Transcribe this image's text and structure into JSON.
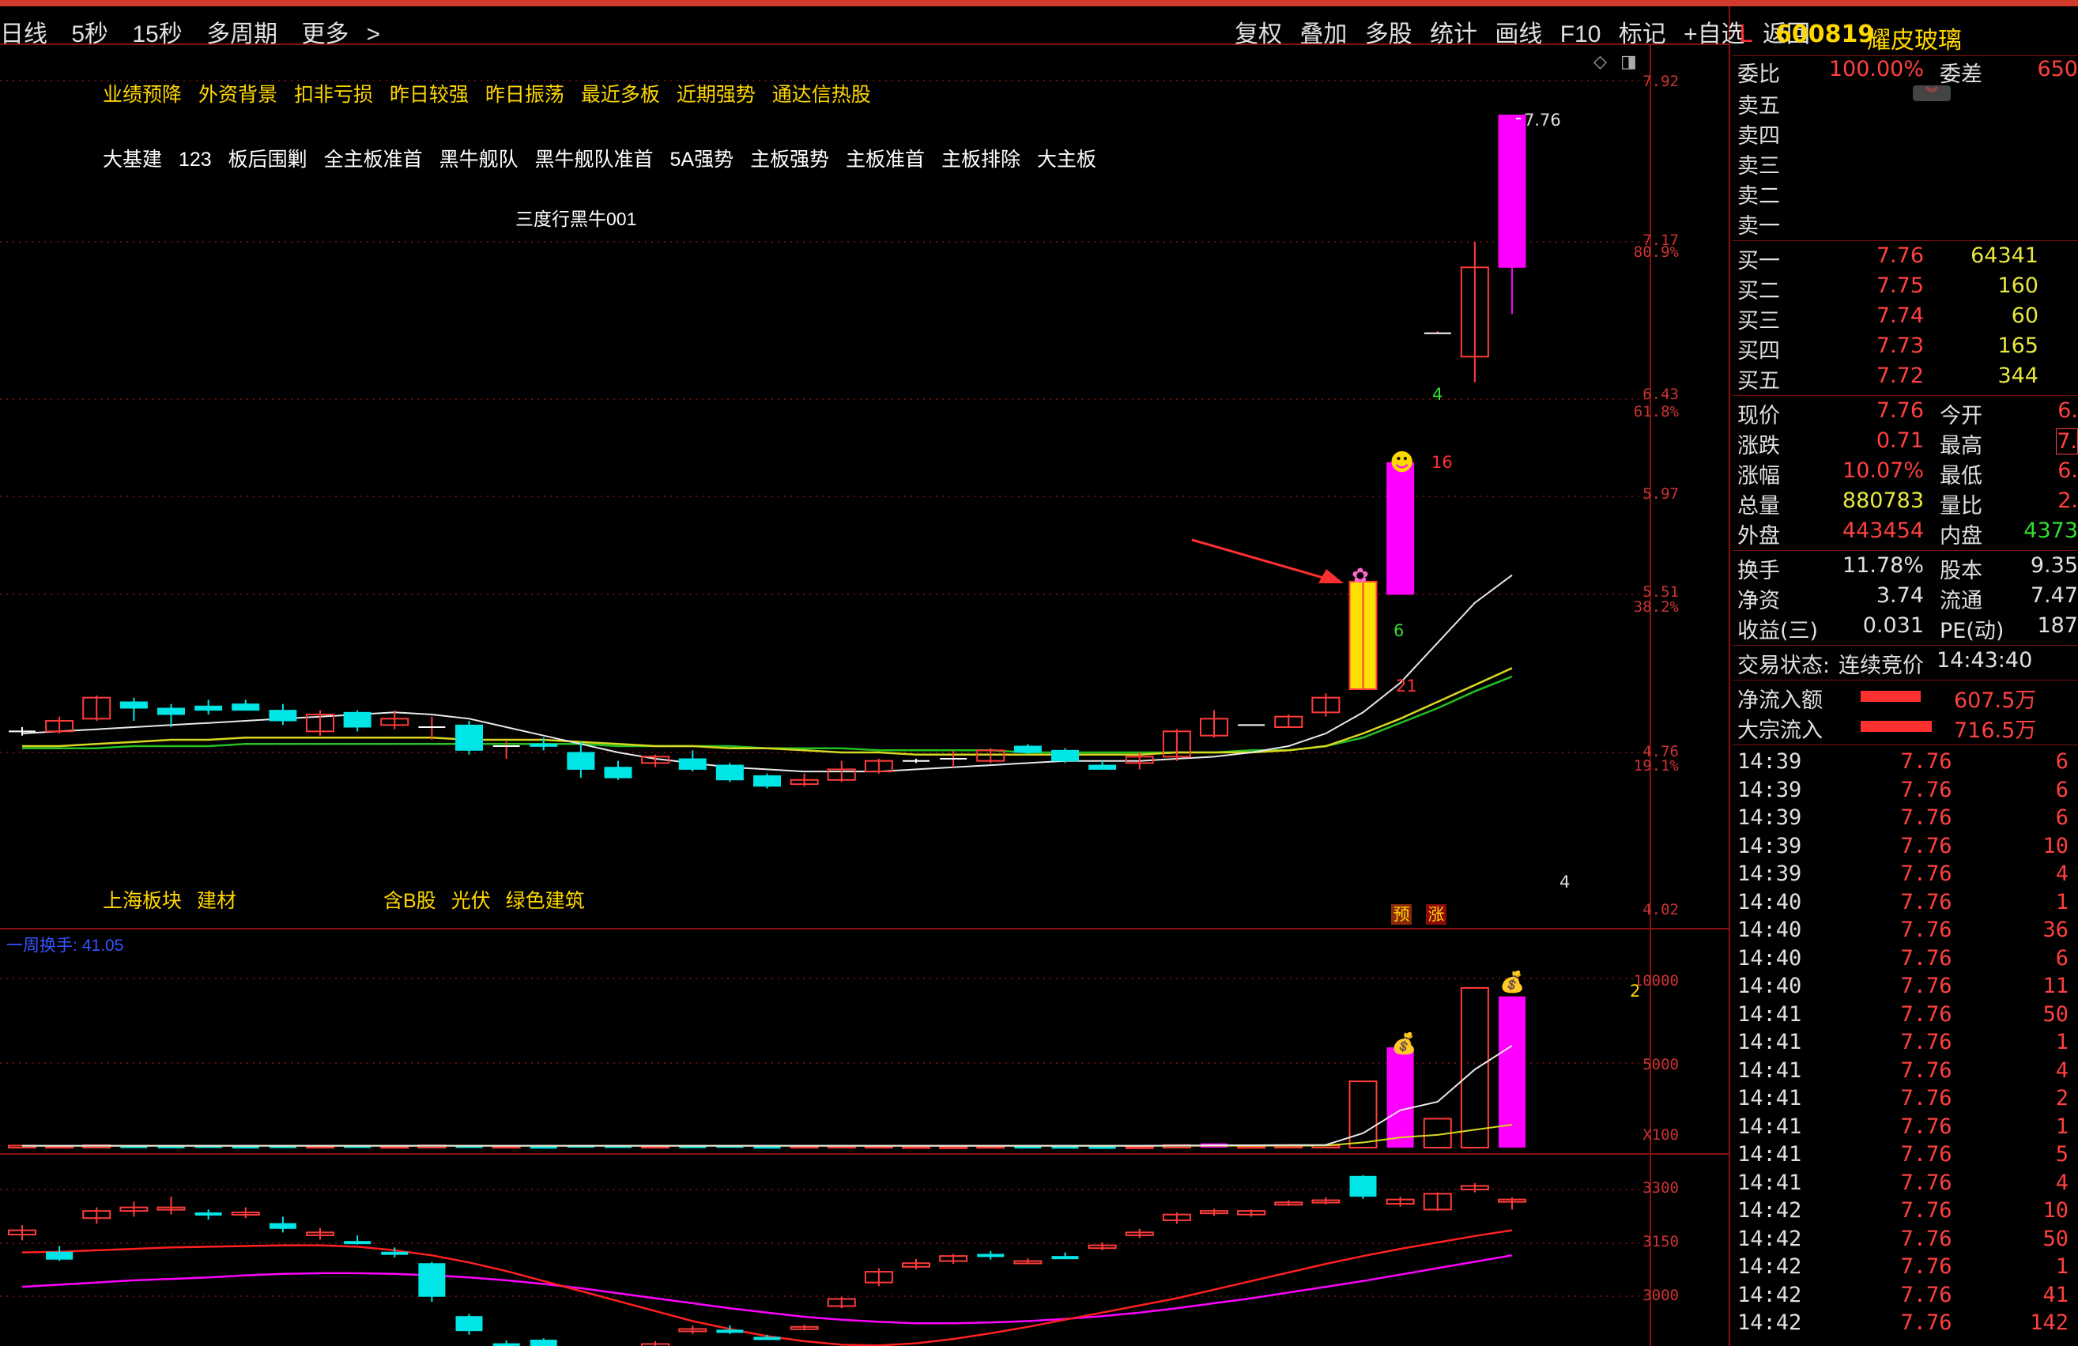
{
  "toolbar": {
    "left": [
      "日线",
      "5秒",
      "15秒",
      "多周期",
      "更多"
    ],
    "right": [
      "复权",
      "叠加",
      "多股",
      "统计",
      "画线",
      "F10",
      "标记",
      "+自选",
      "返回"
    ]
  },
  "tags": {
    "yellow": [
      "业绩预降",
      "外资背景",
      "扣非亏损",
      "昨日较强",
      "昨日振荡",
      "最近多板",
      "近期强势",
      "通达信热股"
    ],
    "white": [
      "大基建",
      "123",
      "板后围剿",
      "全主板准首",
      "黑牛舰队",
      "黑牛舰队准首",
      "5A强势",
      "主板强势",
      "主板准首",
      "主板排除",
      "大主板"
    ]
  },
  "formula_name": "三度行黑牛001",
  "board_left": [
    "上海板块",
    "建材"
  ],
  "board_mid": [
    "含B股",
    "光伏",
    "绿色建筑"
  ],
  "chart_labels": {
    "high_price": "7.76",
    "counts": [
      "21",
      "6",
      "16",
      "4",
      "4",
      "2"
    ],
    "yu": "预",
    "zhang": "涨"
  },
  "price_axis": [
    "7.92",
    "7.17",
    "6.43",
    "5.97",
    "5.51",
    "4.76",
    "4.02"
  ],
  "pct_axis": [
    "80.9%",
    "61.8%",
    "38.2%",
    "19.1%"
  ],
  "vol_title": {
    "label": "一周换手:",
    "value": "41.05"
  },
  "vol_axis": [
    "10000",
    "5000",
    "X100"
  ],
  "ind_axis": [
    "3300",
    "3150",
    "3000"
  ],
  "chart_data": {
    "type": "candlestick",
    "candles": [
      [
        4.86,
        4.86,
        4.88,
        4.84
      ],
      [
        4.86,
        4.91,
        4.93,
        4.85
      ],
      [
        4.92,
        5.02,
        5.03,
        4.91
      ],
      [
        5.0,
        4.97,
        5.02,
        4.91
      ],
      [
        4.97,
        4.94,
        4.99,
        4.88
      ],
      [
        4.98,
        4.96,
        5.01,
        4.94
      ],
      [
        4.99,
        4.96,
        5.01,
        4.96
      ],
      [
        4.96,
        4.91,
        4.99,
        4.89
      ],
      [
        4.86,
        4.94,
        4.96,
        4.84
      ],
      [
        4.95,
        4.88,
        4.96,
        4.86
      ],
      [
        4.89,
        4.92,
        4.96,
        4.87
      ],
      [
        4.88,
        4.88,
        4.93,
        4.82
      ],
      [
        4.89,
        4.77,
        4.91,
        4.75
      ],
      [
        4.79,
        4.79,
        4.81,
        4.73
      ],
      [
        4.8,
        4.79,
        4.83,
        4.77
      ],
      [
        4.76,
        4.68,
        4.81,
        4.64
      ],
      [
        4.69,
        4.64,
        4.72,
        4.63
      ],
      [
        4.71,
        4.74,
        4.75,
        4.69
      ],
      [
        4.73,
        4.68,
        4.77,
        4.67
      ],
      [
        4.7,
        4.63,
        4.71,
        4.62
      ],
      [
        4.65,
        4.6,
        4.66,
        4.59
      ],
      [
        4.61,
        4.63,
        4.66,
        4.6
      ],
      [
        4.63,
        4.68,
        4.72,
        4.62
      ],
      [
        4.67,
        4.72,
        4.73,
        4.66
      ],
      [
        4.72,
        4.72,
        4.73,
        4.71
      ],
      [
        4.73,
        4.73,
        4.77,
        4.69
      ],
      [
        4.72,
        4.77,
        4.78,
        4.71
      ],
      [
        4.79,
        4.76,
        4.8,
        4.75
      ],
      [
        4.77,
        4.72,
        4.78,
        4.71
      ],
      [
        4.7,
        4.68,
        4.72,
        4.68
      ],
      [
        4.71,
        4.74,
        4.76,
        4.68
      ],
      [
        4.74,
        4.86,
        4.87,
        4.72
      ],
      [
        4.84,
        4.92,
        4.96,
        4.83
      ],
      [
        4.89,
        4.89,
        4.89,
        4.89
      ],
      [
        4.88,
        4.93,
        4.94,
        4.88
      ],
      [
        4.95,
        5.02,
        5.04,
        4.93
      ],
      [
        5.06,
        5.57,
        5.57,
        5.06
      ],
      [
        5.51,
        6.13,
        6.13,
        5.51
      ],
      [
        6.74,
        6.74,
        6.75,
        6.74
      ],
      [
        6.63,
        7.05,
        7.17,
        6.51
      ],
      [
        7.05,
        7.76,
        7.76,
        6.83
      ]
    ],
    "ma_white": [
      4.85,
      4.86,
      4.87,
      4.88,
      4.89,
      4.9,
      4.91,
      4.92,
      4.93,
      4.94,
      4.95,
      4.94,
      4.92,
      4.88,
      4.84,
      4.8,
      4.76,
      4.73,
      4.71,
      4.69,
      4.68,
      4.67,
      4.67,
      4.67,
      4.68,
      4.69,
      4.7,
      4.71,
      4.72,
      4.72,
      4.72,
      4.73,
      4.74,
      4.76,
      4.79,
      4.85,
      4.95,
      5.09,
      5.28,
      5.47,
      5.6
    ],
    "ma_yellow": [
      4.79,
      4.79,
      4.8,
      4.81,
      4.82,
      4.82,
      4.83,
      4.83,
      4.83,
      4.83,
      4.83,
      4.83,
      4.82,
      4.82,
      4.82,
      4.81,
      4.8,
      4.79,
      4.79,
      4.78,
      4.78,
      4.77,
      4.76,
      4.76,
      4.75,
      4.75,
      4.75,
      4.75,
      4.75,
      4.75,
      4.75,
      4.76,
      4.76,
      4.76,
      4.77,
      4.79,
      4.85,
      4.92,
      5.0,
      5.08,
      5.16
    ],
    "ma_green": [
      4.78,
      4.78,
      4.78,
      4.79,
      4.79,
      4.79,
      4.8,
      4.8,
      4.8,
      4.8,
      4.8,
      4.8,
      4.8,
      4.8,
      4.8,
      4.8,
      4.79,
      4.79,
      4.79,
      4.79,
      4.78,
      4.78,
      4.78,
      4.77,
      4.77,
      4.77,
      4.77,
      4.76,
      4.76,
      4.76,
      4.76,
      4.76,
      4.76,
      4.77,
      4.77,
      4.79,
      4.83,
      4.9,
      4.97,
      5.05,
      5.12
    ],
    "volume": [
      120,
      90,
      140,
      110,
      100,
      120,
      90,
      110,
      90,
      120,
      80,
      130,
      120,
      90,
      80,
      150,
      120,
      90,
      110,
      130,
      80,
      90,
      100,
      90,
      70,
      60,
      80,
      90,
      80,
      70,
      60,
      150,
      250,
      80,
      100,
      120,
      3900,
      5900,
      1700,
      9400,
      8900
    ],
    "volume_ma": [
      110,
      110,
      110,
      110,
      110,
      110,
      110,
      110,
      110,
      110,
      110,
      110,
      110,
      110,
      110,
      110,
      110,
      110,
      110,
      110,
      110,
      110,
      110,
      110,
      110,
      110,
      110,
      110,
      110,
      110,
      110,
      120,
      140,
      140,
      150,
      160,
      850,
      2200,
      2700,
      4600,
      6000
    ],
    "volume_ma2": [
      100,
      100,
      100,
      100,
      100,
      100,
      100,
      100,
      100,
      100,
      100,
      100,
      100,
      100,
      100,
      100,
      100,
      100,
      100,
      100,
      100,
      100,
      100,
      100,
      100,
      100,
      100,
      100,
      100,
      100,
      100,
      105,
      110,
      110,
      115,
      120,
      300,
      600,
      750,
      1050,
      1350
    ],
    "index": [
      [
        3237,
        3243,
        3250,
        3229
      ],
      [
        3213,
        3202,
        3221,
        3200
      ],
      [
        3260,
        3270,
        3275,
        3252
      ],
      [
        3270,
        3275,
        3283,
        3262
      ],
      [
        3274,
        3275,
        3290,
        3265
      ],
      [
        3268,
        3265,
        3272,
        3258
      ],
      [
        3265,
        3268,
        3275,
        3260
      ],
      [
        3253,
        3245,
        3262,
        3240
      ],
      [
        3236,
        3240,
        3246,
        3230
      ],
      [
        3228,
        3227,
        3236,
        3223
      ],
      [
        3213,
        3210,
        3219,
        3205
      ],
      [
        3197,
        3150,
        3199,
        3143
      ],
      [
        3123,
        3102,
        3126,
        3097
      ],
      [
        3085,
        3083,
        3089,
        3078
      ],
      [
        3090,
        3063,
        3092,
        3056
      ],
      [
        3044,
        3040,
        3048,
        3034
      ],
      [
        3048,
        3060,
        3064,
        3045
      ],
      [
        3075,
        3084,
        3088,
        3073
      ],
      [
        3103,
        3105,
        3110,
        3098
      ],
      [
        3104,
        3101,
        3110,
        3098
      ],
      [
        3094,
        3093,
        3097,
        3090
      ],
      [
        3105,
        3108,
        3111,
        3103
      ],
      [
        3137,
        3147,
        3150,
        3134
      ],
      [
        3170,
        3185,
        3190,
        3165
      ],
      [
        3192,
        3197,
        3203,
        3188
      ],
      [
        3200,
        3207,
        3210,
        3196
      ],
      [
        3210,
        3206,
        3214,
        3202
      ],
      [
        3200,
        3200,
        3204,
        3197
      ],
      [
        3207,
        3206,
        3212,
        3204
      ],
      [
        3218,
        3222,
        3226,
        3215
      ],
      [
        3236,
        3240,
        3245,
        3232
      ],
      [
        3257,
        3265,
        3268,
        3252
      ],
      [
        3267,
        3270,
        3273,
        3263
      ],
      [
        3265,
        3270,
        3272,
        3262
      ],
      [
        3280,
        3282,
        3285,
        3277
      ],
      [
        3283,
        3285,
        3289,
        3279
      ],
      [
        3319,
        3290,
        3320,
        3287
      ],
      [
        3280,
        3286,
        3290,
        3276
      ],
      [
        3272,
        3294,
        3296,
        3270
      ],
      [
        3300,
        3305,
        3309,
        3296
      ],
      [
        3283,
        3286,
        3289,
        3272
      ]
    ],
    "index_ma_red": [
      3212,
      3213,
      3215,
      3217,
      3219,
      3220,
      3221,
      3222,
      3222,
      3220,
      3215,
      3208,
      3198,
      3186,
      3172,
      3158,
      3144,
      3130,
      3116,
      3105,
      3095,
      3088,
      3083,
      3082,
      3085,
      3091,
      3099,
      3108,
      3118,
      3128,
      3138,
      3148,
      3160,
      3172,
      3184,
      3196,
      3207,
      3217,
      3226,
      3235,
      3243
    ],
    "index_ma_magenta": [
      3164,
      3167,
      3170,
      3173,
      3175,
      3177,
      3180,
      3182,
      3183,
      3183,
      3182,
      3180,
      3177,
      3173,
      3168,
      3162,
      3155,
      3148,
      3141,
      3134,
      3128,
      3122,
      3118,
      3115,
      3113,
      3113,
      3114,
      3116,
      3119,
      3123,
      3128,
      3134,
      3141,
      3148,
      3156,
      3164,
      3172,
      3181,
      3190,
      3199,
      3208
    ]
  },
  "quote": {
    "l_mark": "L",
    "code": "600819",
    "name": "耀皮玻璃",
    "weibi": {
      "label": "委比",
      "value": "100.00%",
      "label2": "委差",
      "value2": "650"
    },
    "sell": [
      {
        "label": "卖五"
      },
      {
        "label": "卖四"
      },
      {
        "label": "卖三"
      },
      {
        "label": "卖二"
      },
      {
        "label": "卖一"
      }
    ],
    "buy": [
      {
        "label": "买一",
        "price": "7.76",
        "vol": "64341"
      },
      {
        "label": "买二",
        "price": "7.75",
        "vol": "160"
      },
      {
        "label": "买三",
        "price": "7.74",
        "vol": "60"
      },
      {
        "label": "买四",
        "price": "7.73",
        "vol": "165"
      },
      {
        "label": "买五",
        "price": "7.72",
        "vol": "344"
      }
    ],
    "stats": [
      {
        "l1": "现价",
        "v1": "7.76",
        "l2": "今开",
        "v2": "6."
      },
      {
        "l1": "涨跌",
        "v1": "0.71",
        "l2": "最高",
        "v2": "7."
      },
      {
        "l1": "涨幅",
        "v1": "10.07%",
        "l2": "最低",
        "v2": "6."
      },
      {
        "l1": "总量",
        "v1": "880783",
        "l2": "量比",
        "v2": "2."
      },
      {
        "l1": "外盘",
        "v1": "443454",
        "l2": "内盘",
        "v2": "4373"
      }
    ],
    "stats2": [
      {
        "l1": "换手",
        "v1": "11.78%",
        "l2": "股本",
        "v2": "9.35"
      },
      {
        "l1": "净资",
        "v1": "3.74",
        "l2": "流通",
        "v2": "7.47"
      },
      {
        "l1": "收益(三)",
        "v1": "0.031",
        "l2": "PE(动)",
        "v2": "187"
      }
    ],
    "status": {
      "label": "交易状态:",
      "value": "连续竞价",
      "time": "14:43:40"
    },
    "flow": [
      {
        "label": "净流入额",
        "value": "607.5万"
      },
      {
        "label": "大宗流入",
        "value": "716.5万"
      }
    ],
    "ticks": [
      [
        "14:39",
        "7.76",
        "6"
      ],
      [
        "14:39",
        "7.76",
        "6"
      ],
      [
        "14:39",
        "7.76",
        "6"
      ],
      [
        "14:39",
        "7.76",
        "10"
      ],
      [
        "14:39",
        "7.76",
        "4"
      ],
      [
        "14:40",
        "7.76",
        "1"
      ],
      [
        "14:40",
        "7.76",
        "36"
      ],
      [
        "14:40",
        "7.76",
        "6"
      ],
      [
        "14:40",
        "7.76",
        "11"
      ],
      [
        "14:41",
        "7.76",
        "50"
      ],
      [
        "14:41",
        "7.76",
        "1"
      ],
      [
        "14:41",
        "7.76",
        "4"
      ],
      [
        "14:41",
        "7.76",
        "2"
      ],
      [
        "14:41",
        "7.76",
        "1"
      ],
      [
        "14:41",
        "7.76",
        "5"
      ],
      [
        "14:41",
        "7.76",
        "4"
      ],
      [
        "14:42",
        "7.76",
        "10"
      ],
      [
        "14:42",
        "7.76",
        "50"
      ],
      [
        "14:42",
        "7.76",
        "1"
      ],
      [
        "14:42",
        "7.76",
        "41"
      ],
      [
        "14:42",
        "7.76",
        "142"
      ]
    ]
  }
}
